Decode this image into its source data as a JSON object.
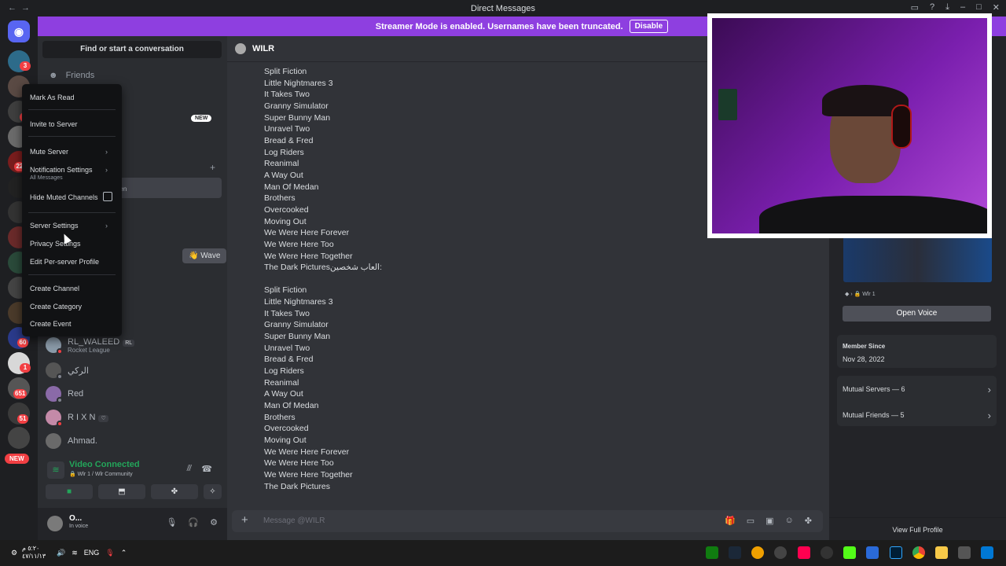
{
  "window": {
    "title": "Direct Messages"
  },
  "banner": {
    "text": "Streamer Mode is enabled. Usernames have been truncated.",
    "disable_label": "Disable"
  },
  "servers": {
    "badges": [
      "3",
      "1",
      "22",
      "60",
      "1",
      "651",
      "51"
    ],
    "new_label": "NEW"
  },
  "sidebar": {
    "search_label": "Find or start a conversation",
    "friends_label": "Friends",
    "new_label": "NEW",
    "selected_fragment": "een",
    "wave_label": "Wave",
    "dms": [
      {
        "name": "RL_WALEED",
        "tag": "RL",
        "sub": "Rocket League"
      },
      {
        "name": "الركي",
        "tag": "",
        "sub": ""
      },
      {
        "name": "Red",
        "tag": "",
        "sub": ""
      },
      {
        "name": "R I X N",
        "tag": "♡",
        "sub": ""
      },
      {
        "name": "Ahmad.",
        "tag": "",
        "sub": ""
      }
    ]
  },
  "context_menu": {
    "items": [
      {
        "label": "Mark As Read"
      },
      {
        "label": "Invite to Server"
      },
      {
        "label": "Mute Server"
      },
      {
        "label": "Notification Settings",
        "sub": "All Messages"
      },
      {
        "label": "Hide Muted Channels"
      },
      {
        "label": "Server Settings"
      },
      {
        "label": "Privacy Settings"
      },
      {
        "label": "Edit Per-server Profile"
      },
      {
        "label": "Create Channel"
      },
      {
        "label": "Create Category"
      },
      {
        "label": "Create Event"
      }
    ]
  },
  "voice": {
    "status": "Video Connected",
    "channel": "Wlr 1 / Wlr Community"
  },
  "user": {
    "name": "O...",
    "status": "In voice"
  },
  "chat": {
    "recipient": "WILR",
    "composer_placeholder": "Message @WILR",
    "block1": [
      "Split Fiction",
      "Little Nightmares 3",
      "It Takes Two",
      "Granny Simulator",
      "Super Bunny Man",
      "Unravel Two",
      " Bread & Fred",
      "Log Riders",
      "Reanimal",
      "A Way Out",
      "Man Of Medan",
      "Brothers",
      "Overcooked",
      "Moving Out",
      "We Were Here Forever",
      "We Were Here Too",
      "We Were Here Together",
      "The Dark Picturesالعاب شخصين:"
    ],
    "block2": [
      "Split Fiction",
      "Little Nightmares 3",
      "It Takes Two",
      "Granny Simulator",
      "Super Bunny Man",
      "Unravel Two",
      " Bread & Fred",
      "Log Riders",
      "Reanimal",
      "A Way Out",
      "Man Of Medan",
      "Brothers",
      "Overcooked",
      "Moving Out",
      "We Were Here Forever",
      "We Were Here Too",
      "We Were Here Together",
      "The Dark Pictures"
    ]
  },
  "profile": {
    "activity": "Wlr 1",
    "open_voice": "Open Voice",
    "member_since_label": "Member Since",
    "member_since": "Nov 28, 2022",
    "mutual_servers": "Mutual Servers — 6",
    "mutual_friends": "Mutual Friends — 5",
    "view_full": "View Full Profile"
  },
  "taskbar": {
    "clock": "٥:٢٠ م",
    "date": "٤٧/١١/١٣",
    "lang": "ENG"
  },
  "colors": {
    "accent": "#5865f2",
    "streamer_banner": "#8e3fe0",
    "online_green": "#23a55a",
    "dnd_red": "#f23f43"
  }
}
